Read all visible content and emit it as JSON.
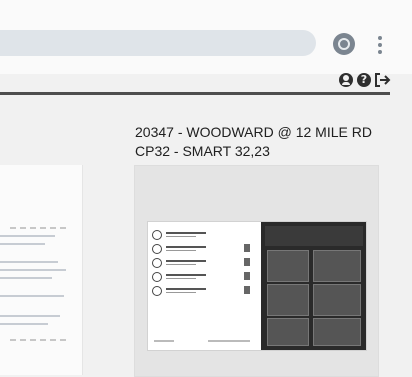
{
  "stop": {
    "title_line1": "20347 - WOODWARD @ 12 MILE RD",
    "title_line2": "CP32 - SMART 32,23"
  },
  "icons": {
    "account": "account-circle-icon",
    "more": "more-vert-icon",
    "user": "user-icon",
    "help": "help-icon",
    "logout": "logout-icon"
  },
  "colors": {
    "search_bg": "#dfe4e9",
    "divider": "#4e4e4e",
    "preview_bg": "#e4e4e4"
  }
}
